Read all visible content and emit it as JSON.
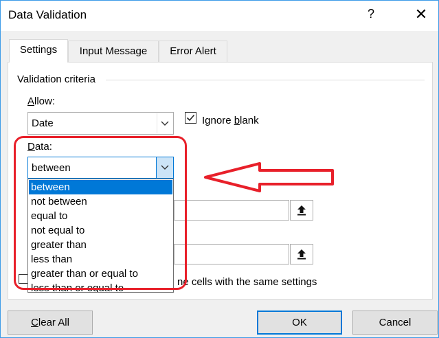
{
  "window": {
    "title": "Data Validation",
    "help_glyph": "?",
    "close_glyph": "✕"
  },
  "tabs": [
    {
      "label": "Settings",
      "active": true
    },
    {
      "label": "Input Message",
      "active": false
    },
    {
      "label": "Error Alert",
      "active": false
    }
  ],
  "settings": {
    "group_label": "Validation criteria",
    "allow_label_pre": "",
    "allow_label_accel": "A",
    "allow_label_post": "llow:",
    "allow_value": "Date",
    "ignore_blank_pre": "Ignore ",
    "ignore_blank_accel": "b",
    "ignore_blank_post": "lank",
    "ignore_blank_checked": true,
    "data_label_pre": "",
    "data_label_accel": "D",
    "data_label_post": "ata:",
    "data_value": "between",
    "data_options": [
      "between",
      "not between",
      "equal to",
      "not equal to",
      "greater than",
      "less than",
      "greater than or equal to",
      "less than or equal to"
    ],
    "selected_option": "between",
    "apply_text": "ne cells with the same settings"
  },
  "footer": {
    "clear_all_pre": "",
    "clear_all_accel": "C",
    "clear_all_post": "lear All",
    "ok_label": "OK",
    "cancel_label": "Cancel"
  },
  "annotation": {
    "highlight_color": "#e8202a"
  },
  "colors": {
    "accent": "#0078d7",
    "selection": "#0078d7"
  }
}
